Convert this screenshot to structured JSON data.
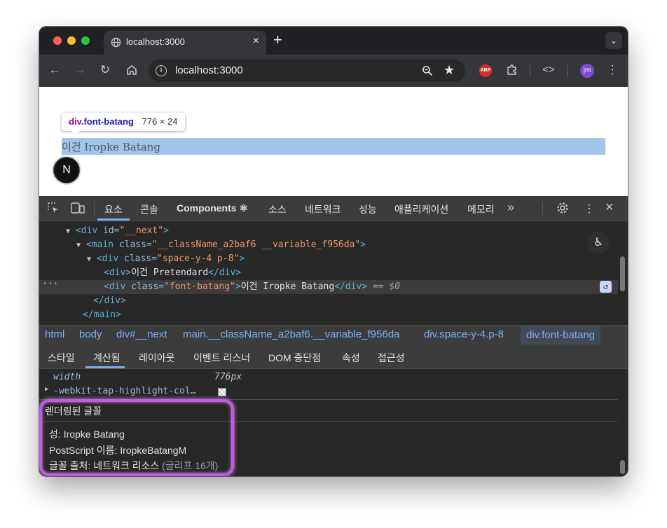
{
  "browser": {
    "tab_title": "localhost:3000",
    "url": "localhost:3000",
    "avatar_initials": "jm",
    "extension_badge": "ABP"
  },
  "page": {
    "tooltip_tag": "div",
    "tooltip_class": ".font-batang",
    "tooltip_size": "776 × 24",
    "highlighted_text": "이건 Iropke Batang",
    "next_badge": "N"
  },
  "devtools": {
    "tabs": [
      "요소",
      "콘솔",
      "Components ⚛",
      "소스",
      "네트워크",
      "성능",
      "애플리케이션",
      "메모리"
    ],
    "dom": {
      "line1": {
        "tag_open": "<div ",
        "attr": "id",
        "eq": "=",
        "val": "\"__next\"",
        "close": ">"
      },
      "line2": {
        "tag_open": "<main ",
        "attr": "class",
        "eq": "=",
        "val": "\"__className_a2baf6 __variable_f956da\"",
        "close": ">"
      },
      "line3": {
        "tag_open": "<div ",
        "attr": "class",
        "eq": "=",
        "val": "\"space-y-4 p-8\"",
        "close": ">"
      },
      "line4": {
        "tag_open": "<div>",
        "text": "이건 Pretendard",
        "tag_close": "</div>"
      },
      "line5": {
        "tag_open": "<div ",
        "attr": "class",
        "eq": "=",
        "val": "\"font-batang\"",
        "close": ">",
        "text": "이건 Iropke Batang",
        "tag_close": "</div>",
        "suffix": " == $0"
      },
      "line6": {
        "tag_close": "</div>"
      },
      "line7": {
        "tag_close": "</main>"
      }
    },
    "breadcrumbs": [
      "html",
      "body",
      "div#__next",
      "main.__className_a2baf6.__variable_f956da",
      "div.space-y-4.p-8",
      "div.font-batang"
    ],
    "style_tabs": [
      "스타일",
      "계산됨",
      "레이아웃",
      "이벤트 리스너",
      "DOM 중단점",
      "속성",
      "접근성"
    ],
    "computed": {
      "width_name": "width",
      "width_value": "776px",
      "tap_highlight": "-webkit-tap-highlight-col…"
    },
    "rendered_fonts": {
      "heading": "렌더링된 글꼴",
      "family": "성: Iropke Batang",
      "postscript": "PostScript 이름: IropkeBatangM",
      "origin": "글꼴 출처: 네트워크 리소스",
      "origin_detail": "(글리프 16개)"
    }
  },
  "colors": {
    "annotation": "#c45be6",
    "highlight": "#a0c4ea",
    "devtools_accent": "#7cacf8"
  }
}
